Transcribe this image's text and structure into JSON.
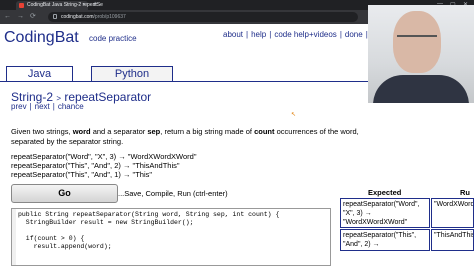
{
  "browser": {
    "tab_title": "CodingBat Java String-2 repeatSe",
    "new_tab": "+",
    "url_host": "codingbat.com",
    "url_path": "/prob/p109637",
    "back": "←",
    "forward": "→",
    "reload": "⟳",
    "minimize": "—",
    "maximize": "▢",
    "close": "✕"
  },
  "site": {
    "logo": "CodingBat",
    "tagline": "code practice",
    "nav": [
      "about",
      "help",
      "code help+videos",
      "done",
      "r"
    ]
  },
  "lang_tabs": [
    "Java",
    "Python"
  ],
  "problem": {
    "section": "String-2",
    "arrow": ">",
    "name": "repeatSeparator",
    "links": [
      "prev",
      "next",
      "chance"
    ],
    "description_parts": [
      "Given two strings, ",
      "word",
      " and a separator ",
      "sep",
      ", return a big string made of ",
      "count",
      " occurrences of the word, separated by the separator string."
    ],
    "examples": [
      "repeatSeparator(\"Word\", \"X\", 3) → \"WordXWordXWord\"",
      "repeatSeparator(\"This\", \"And\", 2) → \"ThisAndThis\"",
      "repeatSeparator(\"This\", \"And\", 1) → \"This\""
    ]
  },
  "go": {
    "label": "Go",
    "hint": "...Save, Compile, Run (ctrl-enter)"
  },
  "editor": {
    "lines": [
      "public String repeatSeparator(String word, String sep, int count) {",
      "  StringBuilder result = new StringBuilder();",
      "",
      "  if(count > 0) {",
      "    result.append(word);"
    ]
  },
  "results": {
    "headers": [
      "Expected",
      "Ru"
    ],
    "rows": [
      {
        "expected": "repeatSeparator(\"Word\", \"X\", 3) → \"WordXWordXWord\"",
        "run": "\"WordXWord"
      },
      {
        "expected": "repeatSeparator(\"This\", \"And\", 2) →",
        "run": "\"ThisAndThis"
      }
    ]
  },
  "colors": {
    "brand": "#1f2e8a",
    "chrome_dark": "#202124"
  }
}
